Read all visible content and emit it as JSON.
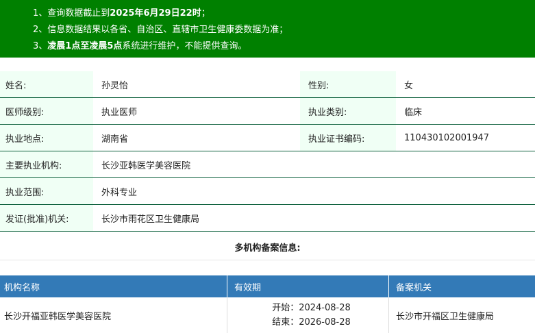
{
  "notice": {
    "line1_prefix": "1、查询数据截止到",
    "line1_bold": "2025年6月29日22时",
    "line1_suffix": "；",
    "line2": "2、信息数据结果以各省、自治区、直辖市卫生健康委数据为准；",
    "line3_prefix": "3、",
    "line3_bold": "凌晨1点至凌晨5点",
    "line3_suffix": "系统进行维护，不能提供查询。"
  },
  "info": {
    "name_label": "姓名:",
    "name_value": "孙灵怡",
    "gender_label": "性别:",
    "gender_value": "女",
    "level_label": "医师级别:",
    "level_value": "执业医师",
    "category_label": "执业类别:",
    "category_value": "临床",
    "location_label": "执业地点:",
    "location_value": "湖南省",
    "cert_label": "执业证书编码:",
    "cert_value": "110430102001947",
    "institution_label": "主要执业机构:",
    "institution_value": "长沙亚韩医学美容医院",
    "scope_label": "执业范围:",
    "scope_value": "外科专业",
    "issuer_label": "发证(批准)机关:",
    "issuer_value": "长沙市雨花区卫生健康局"
  },
  "multi": {
    "title": "多机构备案信息:",
    "headers": {
      "institution": "机构名称",
      "validity": "有效期",
      "authority": "备案机关"
    },
    "rows": [
      {
        "institution": "长沙开福亚韩医学美容医院",
        "start": "开始：2024-08-28",
        "end": "结束：2026-08-28",
        "authority": "长沙市开福区卫生健康局"
      }
    ]
  }
}
